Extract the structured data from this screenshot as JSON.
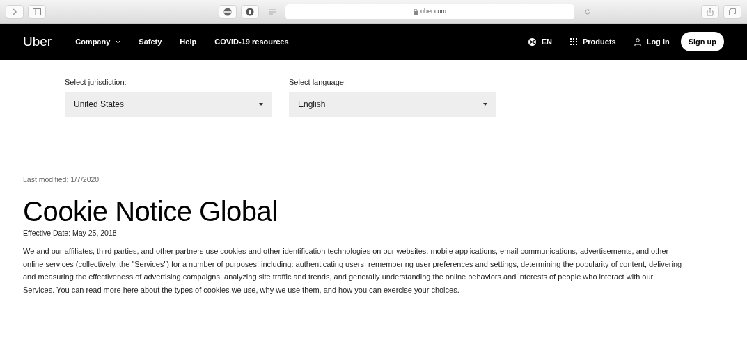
{
  "browser": {
    "url": "uber.com"
  },
  "navbar": {
    "logo": "Uber",
    "links": [
      {
        "label": "Company",
        "dropdown": true
      },
      {
        "label": "Safety",
        "dropdown": false
      },
      {
        "label": "Help",
        "dropdown": false
      },
      {
        "label": "COVID-19 resources",
        "dropdown": false
      }
    ],
    "language": "EN",
    "products": "Products",
    "login": "Log in",
    "signup": "Sign up"
  },
  "selects": [
    {
      "label": "Select jurisdiction:",
      "value": "United States"
    },
    {
      "label": "Select language:",
      "value": "English"
    }
  ],
  "last_modified": "Last modified: 1/7/2020",
  "title": "Cookie Notice Global",
  "effective_date": "Effective Date: May 25, 2018",
  "paragraph": "We and our affiliates, third parties, and other partners use cookies and other identification technologies on our websites, mobile applications, email communications, advertisements, and other online services (collectively, the \"Services\") for a number of purposes, including: authenticating users, remembering user preferences and settings, determining the popularity of content, delivering and measuring the effectiveness of advertising campaigns, analyzing site traffic and trends, and generally understanding the online behaviors and interests of people who interact with our Services. You can read more here about the types of cookies we use, why we use them, and how you can exercise your choices."
}
